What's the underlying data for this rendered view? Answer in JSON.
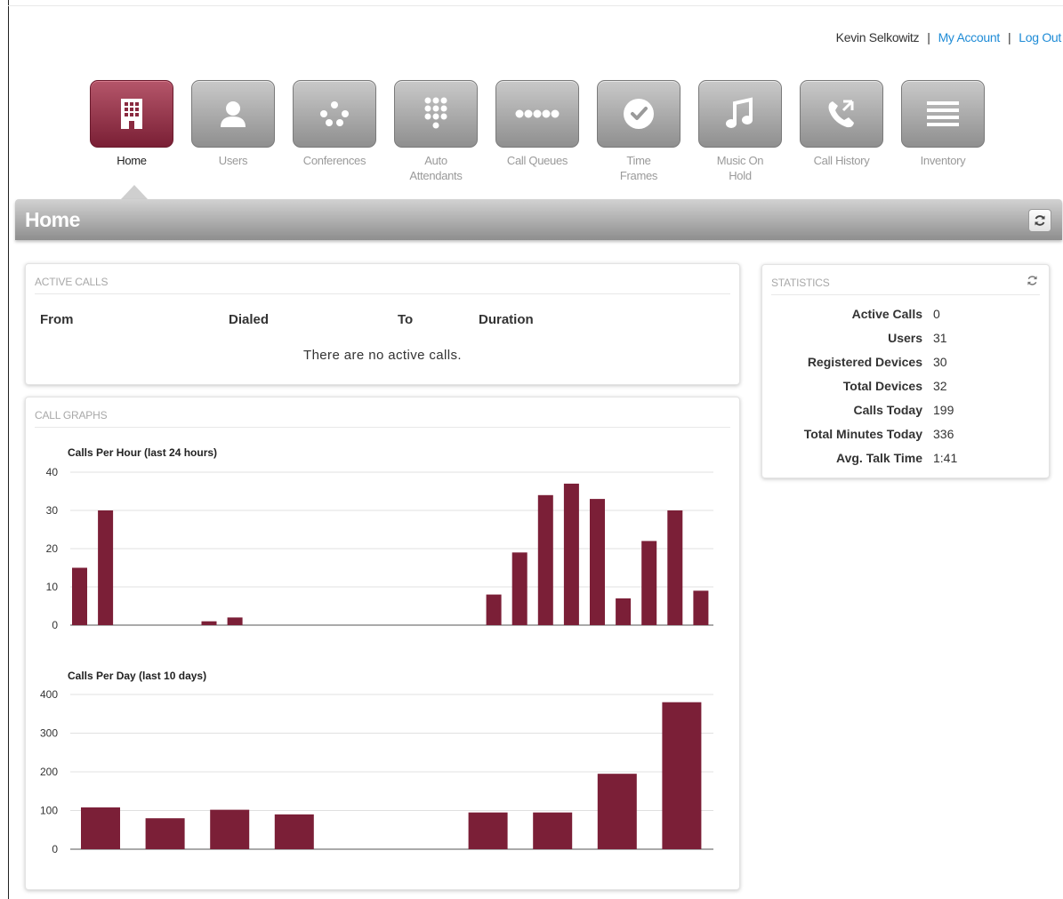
{
  "userbar": {
    "user_name": "Kevin Selkowitz",
    "separator": "|",
    "my_account": "My Account",
    "log_out": "Log Out"
  },
  "nav": {
    "items": [
      {
        "label": "Home",
        "icon": "building-icon",
        "active": true
      },
      {
        "label": "Users",
        "icon": "user-icon",
        "active": false
      },
      {
        "label": "Conferences",
        "icon": "conference-dots-icon",
        "active": false
      },
      {
        "label": "Auto\nAttendants",
        "icon": "keypad-icon",
        "active": false
      },
      {
        "label": "Call Queues",
        "icon": "queue-dots-icon",
        "active": false
      },
      {
        "label": "Time\nFrames",
        "icon": "clock-icon",
        "active": false
      },
      {
        "label": "Music On\nHold",
        "icon": "music-note-icon",
        "active": false
      },
      {
        "label": "Call History",
        "icon": "phone-history-icon",
        "active": false
      },
      {
        "label": "Inventory",
        "icon": "list-lines-icon",
        "active": false
      }
    ]
  },
  "page": {
    "title": "Home"
  },
  "active_calls": {
    "heading": "ACTIVE CALLS",
    "columns": [
      "From",
      "Dialed",
      "To",
      "Duration"
    ],
    "empty_message": "There are no active calls."
  },
  "call_graphs": {
    "heading": "CALL GRAPHS"
  },
  "statistics": {
    "heading": "STATISTICS",
    "rows": [
      {
        "label": "Active Calls",
        "value": "0"
      },
      {
        "label": "Users",
        "value": "31"
      },
      {
        "label": "Registered Devices",
        "value": "30"
      },
      {
        "label": "Total Devices",
        "value": "32"
      },
      {
        "label": "Calls Today",
        "value": "199"
      },
      {
        "label": "Total Minutes Today",
        "value": "336"
      },
      {
        "label": "Avg. Talk Time",
        "value": "1:41"
      }
    ]
  },
  "colors": {
    "bar": "#7b1f37",
    "link": "#1e8bd6",
    "active_nav": "#8a2a40"
  },
  "chart_data": [
    {
      "type": "bar",
      "title": "Calls Per Hour (last 24 hours)",
      "ylim": [
        0,
        40
      ],
      "yticks": [
        0,
        10,
        20,
        30,
        40
      ],
      "values": [
        15,
        30,
        0,
        0,
        0,
        1,
        2,
        0,
        0,
        0,
        0,
        0,
        0,
        0,
        0,
        0,
        8,
        19,
        34,
        37,
        33,
        7,
        22,
        30,
        9
      ],
      "grid": true
    },
    {
      "type": "bar",
      "title": "Calls Per Day (last 10 days)",
      "ylim": [
        0,
        400
      ],
      "yticks": [
        0,
        100,
        200,
        300,
        400
      ],
      "values": [
        108,
        80,
        102,
        90,
        0,
        0,
        95,
        95,
        195,
        380
      ],
      "grid": true
    }
  ]
}
